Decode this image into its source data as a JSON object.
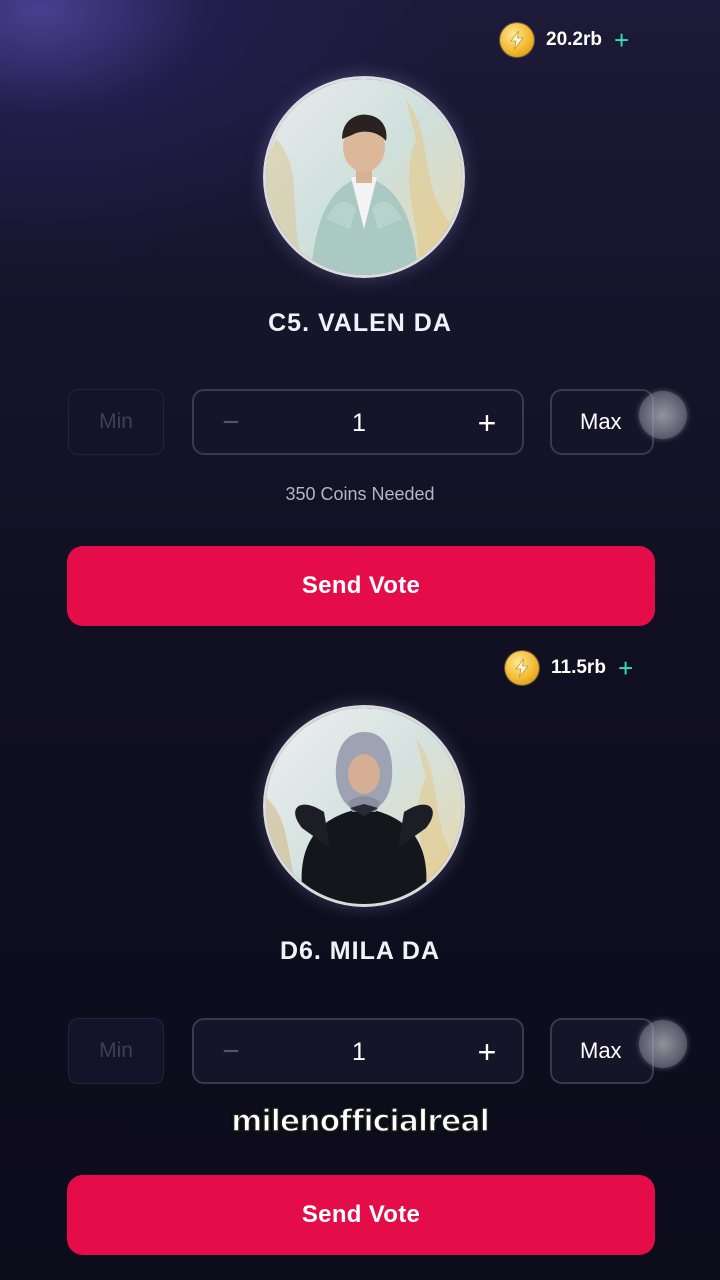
{
  "contestants": [
    {
      "coin_balance": "20.2rb",
      "name": "C5. VALEN DA",
      "min_label": "Min",
      "max_label": "Max",
      "quantity": "1",
      "minus_label": "−",
      "plus_label": "+",
      "coins_needed": "350 Coins Needed",
      "send_label": "Send Vote"
    },
    {
      "coin_balance": "11.5rb",
      "name": "D6. MILA DA",
      "min_label": "Min",
      "max_label": "Max",
      "quantity": "1",
      "minus_label": "−",
      "plus_label": "+",
      "coins_needed": "",
      "send_label": "Send Vote"
    }
  ],
  "icons": {
    "coin": "lightning-coin-icon",
    "add": "plus-icon"
  },
  "colors": {
    "accent": "#e40d4a",
    "coin_add": "#2fe0b8",
    "coin_gold": "#f2b92e"
  },
  "watermark": "milenofficialreal"
}
